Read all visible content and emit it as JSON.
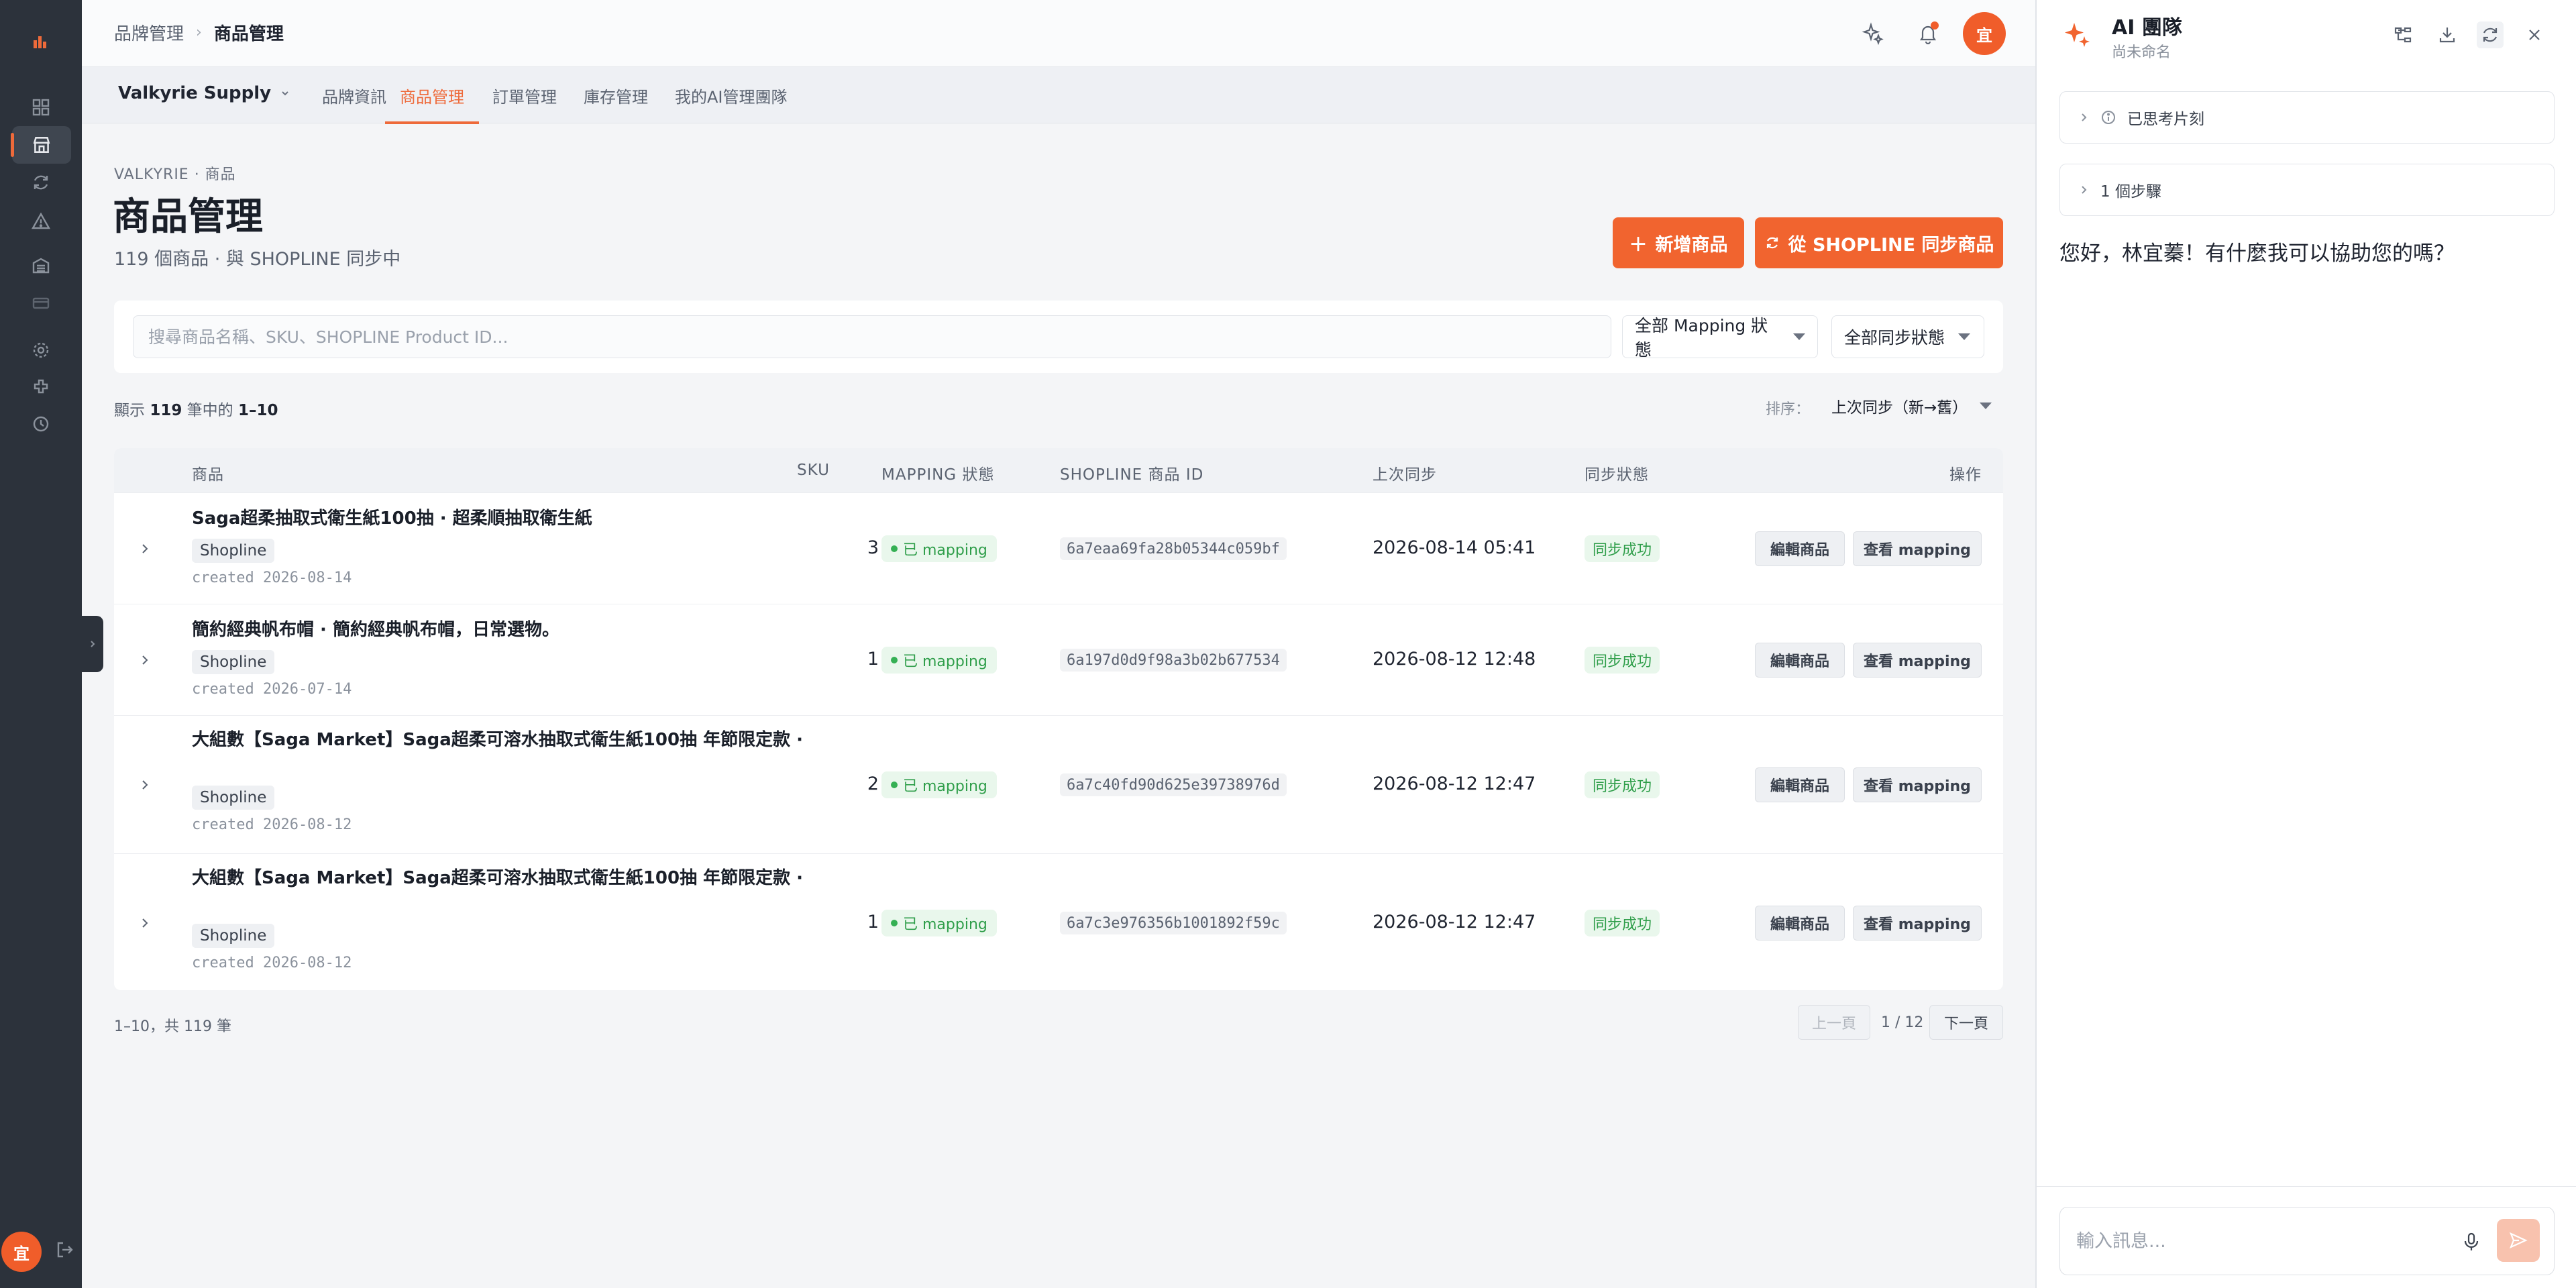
{
  "header": {
    "breadcrumb": [
      "品牌管理",
      "商品管理"
    ],
    "avatar_initial": "宜"
  },
  "tabbar": {
    "brand": "Valkyrie Supply",
    "tabs": [
      {
        "label": "品牌資訊",
        "active": false
      },
      {
        "label": "商品管理",
        "active": true
      },
      {
        "label": "訂單管理",
        "active": false
      },
      {
        "label": "庫存管理",
        "active": false
      },
      {
        "label": "我的AI管理團隊",
        "active": false
      }
    ]
  },
  "page": {
    "overline": "VALKYRIE · 商品",
    "title": "商品管理",
    "subtitle": "119 個商品 · 與 SHOPLINE 同步中",
    "add_button": "新增商品",
    "sync_button": "從 SHOPLINE 同步商品"
  },
  "filters": {
    "search_placeholder": "搜尋商品名稱、SKU、SHOPLINE Product ID...",
    "mapping_filter": "全部 Mapping 狀態",
    "sync_filter": "全部同步狀態"
  },
  "listing": {
    "count_prefix": "顯示",
    "total": "119",
    "count_middle": "筆中的",
    "range": "1–10",
    "sort_label": "排序：",
    "sort_value": "上次同步（新→舊）"
  },
  "table": {
    "columns": [
      "商品",
      "SKU",
      "MAPPING 狀態",
      "SHOPLINE 商品 ID",
      "上次同步",
      "同步狀態",
      "操作"
    ],
    "rows": [
      {
        "name": "Saga超柔抽取式衛生紙100抽 · 超柔順抽取衛生紙",
        "tag": "Shopline",
        "created": "created 2026-08-14",
        "sku": "3",
        "mapping": "已 mapping",
        "product_id": "6a7eaa69fa28b05344c059bf",
        "last_sync": "2026-08-14 05:41",
        "sync_status": "同步成功",
        "edit": "編輯商品",
        "view": "查看 mapping"
      },
      {
        "name": "簡約經典帆布帽 · 簡約經典帆布帽，日常選物。",
        "tag": "Shopline",
        "created": "created 2026-07-14",
        "sku": "1",
        "mapping": "已 mapping",
        "product_id": "6a197d0d9f98a3b02b677534",
        "last_sync": "2026-08-12 12:48",
        "sync_status": "同步成功",
        "edit": "編輯商品",
        "view": "查看 mapping"
      },
      {
        "name": "大組數【Saga Market】Saga超柔可溶水抽取式衛生紙100抽 年節限定款 ·",
        "tag": "Shopline",
        "created": "created 2026-08-12",
        "sku": "2",
        "mapping": "已 mapping",
        "product_id": "6a7c40fd90d625e39738976d",
        "last_sync": "2026-08-12 12:47",
        "sync_status": "同步成功",
        "edit": "編輯商品",
        "view": "查看 mapping"
      },
      {
        "name": "大組數【Saga Market】Saga超柔可溶水抽取式衛生紙100抽 年節限定款 ·",
        "tag": "Shopline",
        "created": "created 2026-08-12",
        "sku": "1",
        "mapping": "已 mapping",
        "product_id": "6a7c3e976356b1001892f59c",
        "last_sync": "2026-08-12 12:47",
        "sync_status": "同步成功",
        "edit": "編輯商品",
        "view": "查看 mapping"
      }
    ]
  },
  "pagination": {
    "summary": "1–10，共 119 筆",
    "prev": "上一頁",
    "page": "1 / 12",
    "next": "下一頁"
  },
  "panel": {
    "title": "AI 團隊",
    "subtitle": "尚未命名",
    "thinking_label": "已思考片刻",
    "steps_label": "1 個步驟",
    "greeting": "您好，林宜蓁！有什麼我可以協助您的嗎？",
    "input_placeholder": "輸入訊息..."
  },
  "rail": {
    "avatar_initial": "宜"
  },
  "colors": {
    "accent": "#f1642f",
    "rail_bg": "#2c323b",
    "success": "#2f9e4a"
  }
}
